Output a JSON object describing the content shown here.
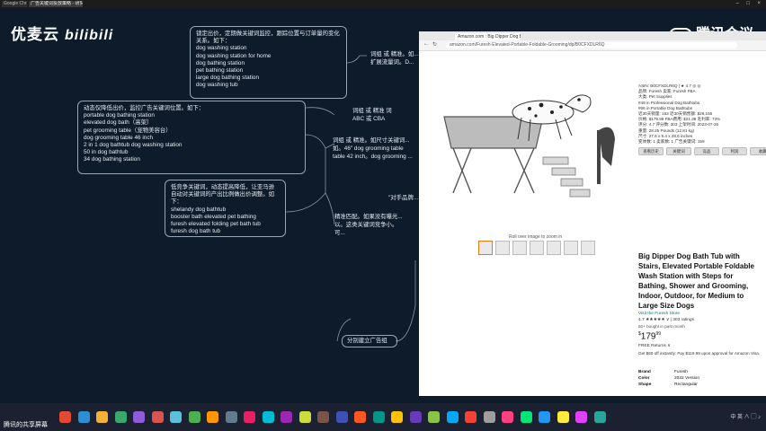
{
  "browser_tabs": [
    {
      "label": "Google Chrome",
      "active": false
    },
    {
      "label": "广告关键词投放策略 - 研究",
      "active": true
    }
  ],
  "overlay": {
    "brand_left": "优麦云",
    "brand_left_logo": "bilibili",
    "brand_right": "腾讯会议"
  },
  "mindmap": {
    "node_positioning": "锁定出价，定期做关键词监控，跟踪位置与订单量的变化关系。如下：\ndog washing station\ndog washing station for home\ndog bathing station\npet bathing station\nlarge dog bathing station\ndog washing tub",
    "node_dynamic": "动态仅降低出价，监控广告关键词位置。如下：\nportable dog bathing station\nelevated dog bath（高架）\npet grooming table（宠物美容台）\ndog grooming table 46 inch\n2 in 1 dog bathtub dog washing station\n50 in dog bathtub\n34 dog bathing station",
    "node_lowbid": "低竞争关键词，动态提高降低，让亚马逊自动对关键词的产出比例做出价调整。如下：\nshelandy dog bathtub\nbooster bath elevated pet bathing\nfuresh elevated folding pet bath tub\nfuresh dog bath tub",
    "text_top_right": "词组 或 精准。如...\n扩展流量词。D...",
    "text_mid_a": "词组 或 精准 词\nABC 或 CBA",
    "text_mid_b": "词组 或 精准。如尺寸关键词...\n如。46\" dog grooming table\ntable 42 inch。dog grooming ...",
    "text_quote": "\"对手品牌...",
    "text_bottom": "精准匹配。如果没有曝光...\n以。这类关键词竞争小。\n可...",
    "text_branch": "分别建立广告组"
  },
  "browser": {
    "tab_label": "Amazon.com : Big Dipper Dog Bath Tub",
    "url": "amazon.com/Furesh-Elevated-Portable-Foldable-Grooming/dp/B0CFXDLR6Q",
    "zoom_hint": "Roll over image to zoom in",
    "panel_rows": [
      "ASIN: B0CFXDLR6Q  |  ★ 4.7  ◎ ◎",
      "品牌: Furesh   卖家: Furesh  FBA",
      "大类: Pet Supplies",
      "#49 in Professional Dog Bathtubs",
      "#66 in Portable Dog Bathtubs",
      "近30天销量: 163   近30天销售额: $29,156",
      "价格: $179.99   FBA费用: $21.38   毛利率: 73%",
      "评分: 4.7   评分数: 303   上架时间: 2023-07-26",
      "重量: 28.25 Pounds (12.81 kg)",
      "尺寸: 27.6 x 9.4 x 28.6 inches",
      "变体数: 1   卖家数: 1   广告关键词: 159"
    ],
    "panel_buttons": [
      "查看历史",
      "关键词",
      "竞品",
      "利润",
      "收藏"
    ],
    "title": "Big Dipper Dog Bath Tub with Stairs, Elevated Portable Foldable Wash Station with Steps for Bathing, Shower and Grooming, Indoor, Outdoor, for Medium to Large Size Dogs",
    "store": "Visit the Furesh Store",
    "rating": "4.7 ★★★★★ ∨  | 303 ratings",
    "bought": "50+ bought in past month",
    "price_whole": "179",
    "price_frac": "99",
    "returns": "FREE Returns ∨",
    "promo": "Get $60 off instantly: Pay $119.99 upon approval for Amazon Visa.",
    "specs": [
      {
        "k": "Brand",
        "v": "Furesh"
      },
      {
        "k": "Color",
        "v": "2022 Version"
      },
      {
        "k": "Shape",
        "v": "Rectangular"
      }
    ]
  },
  "taskbar": {
    "sharer": "腾讯的共享屏幕",
    "tray": "中  英  ∧  ▢  ♪",
    "icon_colors": [
      "#e24a33",
      "#2b8fd6",
      "#f2b134",
      "#3aa86b",
      "#8e5cd6",
      "#d9534f",
      "#5bc0de",
      "#4caf50",
      "#ff9800",
      "#607d8b",
      "#e91e63",
      "#00bcd4",
      "#9c27b0",
      "#cddc39",
      "#795548",
      "#3f51b5",
      "#ff5722",
      "#009688",
      "#ffc107",
      "#673ab7",
      "#8bc34a",
      "#03a9f4",
      "#f44336",
      "#9e9e9e",
      "#ff4081",
      "#00e676",
      "#2196f3",
      "#ffeb3b",
      "#e040fb",
      "#26a69a"
    ]
  }
}
